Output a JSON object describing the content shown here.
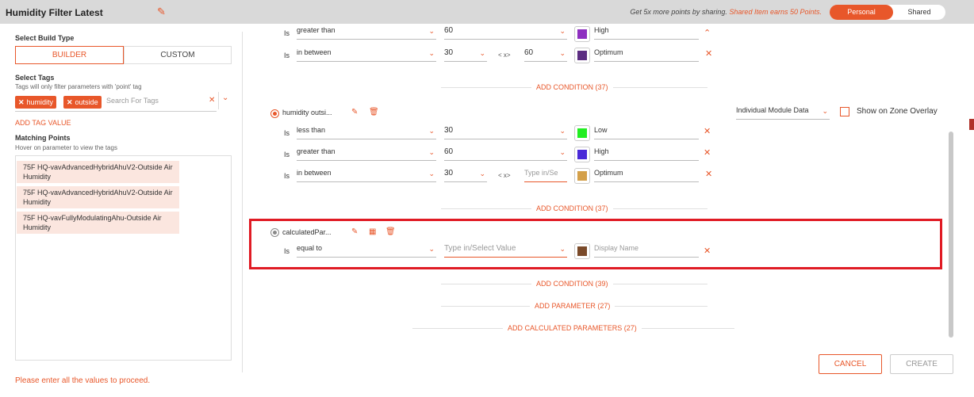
{
  "header": {
    "title": "Humidity Filter Latest",
    "share_prefix": "Get 5x more points by sharing.",
    "share_highlight": "Shared Item earns 50 Points.",
    "toggle_personal": "Personal",
    "toggle_shared": "Shared"
  },
  "left": {
    "build_type_label": "Select Build Type",
    "builder": "BUILDER",
    "custom": "CUSTOM",
    "tags_label": "Select Tags",
    "tags_hint": "Tags will only filter parameters with 'point' tag",
    "tags": [
      "humidity",
      "outside"
    ],
    "tag_search_placeholder": "Search For Tags",
    "add_tag_value": "ADD TAG VALUE",
    "matching_label": "Matching Points",
    "matching_hint": "Hover on parameter to view the tags",
    "points": [
      "75F HQ-vavAdvancedHybridAhuV2-Outside Air Humidity",
      "75F HQ-vavAdvancedHybridAhuV2-Outside Air Humidity",
      "75F HQ-vavFullyModulatingAhu-Outside Air Humidity"
    ],
    "error": "Please enter all the values to proceed."
  },
  "is_label": "Is",
  "range_label": "< x>",
  "block1": {
    "rows": [
      {
        "op": "greater than",
        "v1": "60",
        "color": "#8e2fc0",
        "name": "High"
      },
      {
        "op": "in between",
        "v1": "30",
        "v2": "60",
        "color": "#5c2d82",
        "name": "Optimum"
      }
    ],
    "add_condition": "ADD CONDITION (37)"
  },
  "block2": {
    "param": "humidity outsi...",
    "module_select": "Individual Module Data",
    "zone_overlay": "Show on Zone Overlay",
    "rows": [
      {
        "op": "less than",
        "v1": "30",
        "color": "#22ee22",
        "name": "Low"
      },
      {
        "op": "greater than",
        "v1": "60",
        "color": "#4a2ad8",
        "name": "High"
      },
      {
        "op": "in between",
        "v1": "30",
        "v2_placeholder": "Type in/Se",
        "color": "#d4a04a",
        "name": "Optimum"
      }
    ],
    "add_condition": "ADD CONDITION (37)"
  },
  "block3": {
    "param": "calculatedPar...",
    "row": {
      "op": "equal to",
      "value_placeholder": "Type in/Select Value",
      "color": "#7a4a2a",
      "name_placeholder": "Display Name"
    }
  },
  "footer_links": {
    "add_condition": "ADD CONDITION (39)",
    "add_parameter": "ADD PARAMETER (27)",
    "add_calculated": "ADD CALCULATED PARAMETERS (27)"
  },
  "buttons": {
    "cancel": "CANCEL",
    "create": "CREATE"
  }
}
